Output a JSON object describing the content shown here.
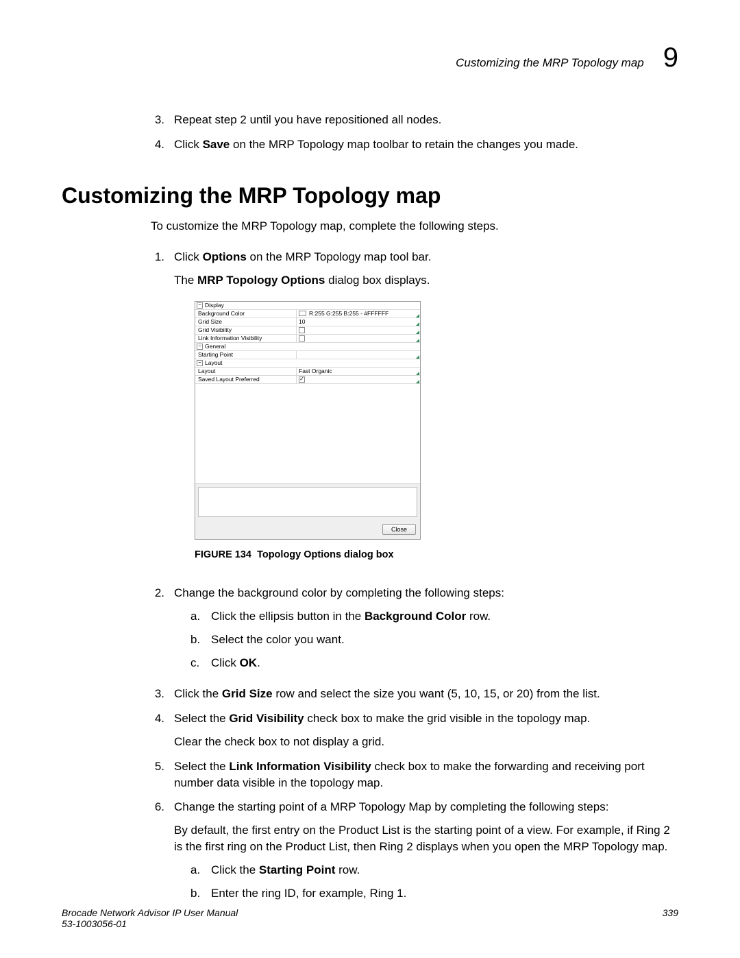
{
  "header": {
    "label": "Customizing the MRP Topology map",
    "chapter": "9"
  },
  "top_steps": [
    {
      "n": "3.",
      "text": "Repeat step 2 until you have repositioned all nodes."
    },
    {
      "n": "4.",
      "prefix": "Click ",
      "bold": "Save",
      "suffix": " on the MRP Topology map toolbar to retain the changes you made."
    }
  ],
  "h1": "Customizing the MRP Topology map",
  "intro": "To customize the MRP Topology map, complete the following steps.",
  "step1": {
    "n": "1.",
    "line1_prefix": "Click ",
    "line1_bold": "Options",
    "line1_suffix": " on the MRP Topology map tool bar.",
    "line2_prefix": "The ",
    "line2_bold": "MRP Topology Options",
    "line2_suffix": " dialog box displays."
  },
  "dialog": {
    "groups": {
      "display": "Display",
      "general": "General",
      "layout": "Layout"
    },
    "rows": {
      "bg_label": "Background Color",
      "bg_value": "R:255 G:255 B:255 - #FFFFFF",
      "grid_size_label": "Grid Size",
      "grid_size_value": "10",
      "grid_vis_label": "Grid Visibility",
      "link_vis_label": "Link Information Visibility",
      "starting_pt_label": "Starting Point",
      "layout_label": "Layout",
      "layout_value": "Fast Organic",
      "saved_pref_label": "Saved Layout Preferred"
    },
    "close": "Close"
  },
  "fig_caption": {
    "id": "FIGURE 134",
    "text": "Topology Options dialog box"
  },
  "step2": {
    "n": "2.",
    "text": "Change the background color by completing the following steps:",
    "subs": {
      "a_prefix": "Click the ellipsis button in the ",
      "a_bold": "Background Color",
      "a_suffix": " row.",
      "b": "Select the color you want.",
      "c_prefix": "Click ",
      "c_bold": "OK",
      "c_suffix": "."
    }
  },
  "step3": {
    "n": "3.",
    "prefix": "Click the ",
    "bold": "Grid Size",
    "suffix": " row and select the size you want (5, 10, 15, or 20) from the list."
  },
  "step4": {
    "n": "4.",
    "prefix": "Select the ",
    "bold": "Grid Visibility",
    "suffix": " check box to make the grid visible in the topology map.",
    "line2": "Clear the check box to not display a grid."
  },
  "step5": {
    "n": "5.",
    "prefix": "Select the ",
    "bold": "Link Information Visibility",
    "suffix": " check box to make the forwarding and receiving port number data visible in the topology map."
  },
  "step6": {
    "n": "6.",
    "text": "Change the starting point of a MRP Topology Map by completing the following steps:",
    "para": "By default, the first entry on the Product List is the starting point of a view. For example, if Ring 2 is the first ring on the Product List, then Ring 2 displays when you open the MRP Topology map.",
    "subs": {
      "a_prefix": "Click the ",
      "a_bold": "Starting Point",
      "a_suffix": " row.",
      "b": "Enter the ring ID, for example, Ring 1."
    }
  },
  "footer": {
    "title": "Brocade Network Advisor IP User Manual",
    "doc": "53-1003056-01",
    "page": "339"
  }
}
